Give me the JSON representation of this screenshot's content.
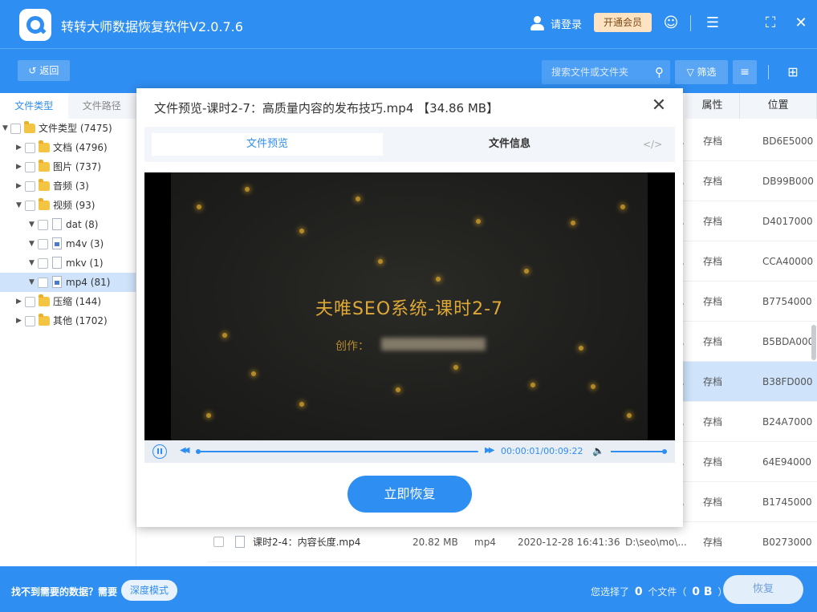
{
  "app": {
    "title": "转转大师数据恢复软件V2.0.7.6",
    "login": "请登录",
    "vip": "开通会员"
  },
  "toolbar": {
    "back": "返回",
    "search_placeholder": "搜索文件或文件夹",
    "filter": "筛选"
  },
  "left": {
    "tabs": [
      "文件类型",
      "文件路径"
    ],
    "tree": [
      {
        "label": "文件类型 (7475)"
      },
      {
        "label": "文档 (4796)"
      },
      {
        "label": "图片 (737)"
      },
      {
        "label": "音频 (3)"
      },
      {
        "label": "视频 (93)"
      },
      {
        "label": "dat (8)"
      },
      {
        "label": "m4v (3)"
      },
      {
        "label": "mkv (1)"
      },
      {
        "label": "mp4 (81)"
      },
      {
        "label": "压缩 (144)"
      },
      {
        "label": "其他 (1702)"
      }
    ]
  },
  "table": {
    "headers": {
      "attr": "属性",
      "location": "位置"
    },
    "rows": [
      {
        "attr": "存档",
        "loc": "BD6E5000"
      },
      {
        "attr": "存档",
        "loc": "DB99B000"
      },
      {
        "attr": "存档",
        "loc": "D4017000"
      },
      {
        "attr": "存档",
        "loc": "CCA40000"
      },
      {
        "attr": "存档",
        "loc": "B7754000"
      },
      {
        "attr": "存档",
        "loc": "B5BDA000"
      },
      {
        "attr": "存档",
        "loc": "B38FD000"
      },
      {
        "attr": "存档",
        "loc": "B24A7000"
      },
      {
        "attr": "存档",
        "loc": "64E94000"
      },
      {
        "attr": "存档",
        "loc": "B1745000"
      }
    ],
    "last_row": {
      "name": "课时2-4：内容长度.mp4",
      "size": "20.82 MB",
      "type": "mp4",
      "date": "2020-12-28 16:41:36",
      "path": "D:\\seo\\mo\\...",
      "attr": "存档",
      "loc": "B0273000"
    }
  },
  "bottom": {
    "hint": "找不到需要的数据？需要",
    "deep_mode": "深度模式",
    "sel_prefix": "您选择了",
    "sel_count": "0",
    "sel_mid": "个文件（",
    "sel_size": "0 B",
    "sel_suffix": "）",
    "recover": "恢复"
  },
  "modal": {
    "title": "文件预览-课时2-7：高质量内容的发布技巧.mp4 【34.86 MB】",
    "tab_preview": "文件预览",
    "tab_info": "文件信息",
    "code": "</>",
    "video_title": "夫唯SEO系统-课时2-7",
    "video_sub": "创作：",
    "time": "00:00:01/00:09:22",
    "recover_now": "立即恢复"
  },
  "colors": {
    "accent": "#2f8ef2",
    "selected_row": "#cfe3fb",
    "vip_bg": "#fde3c2",
    "video_gold": "#e0a936"
  }
}
